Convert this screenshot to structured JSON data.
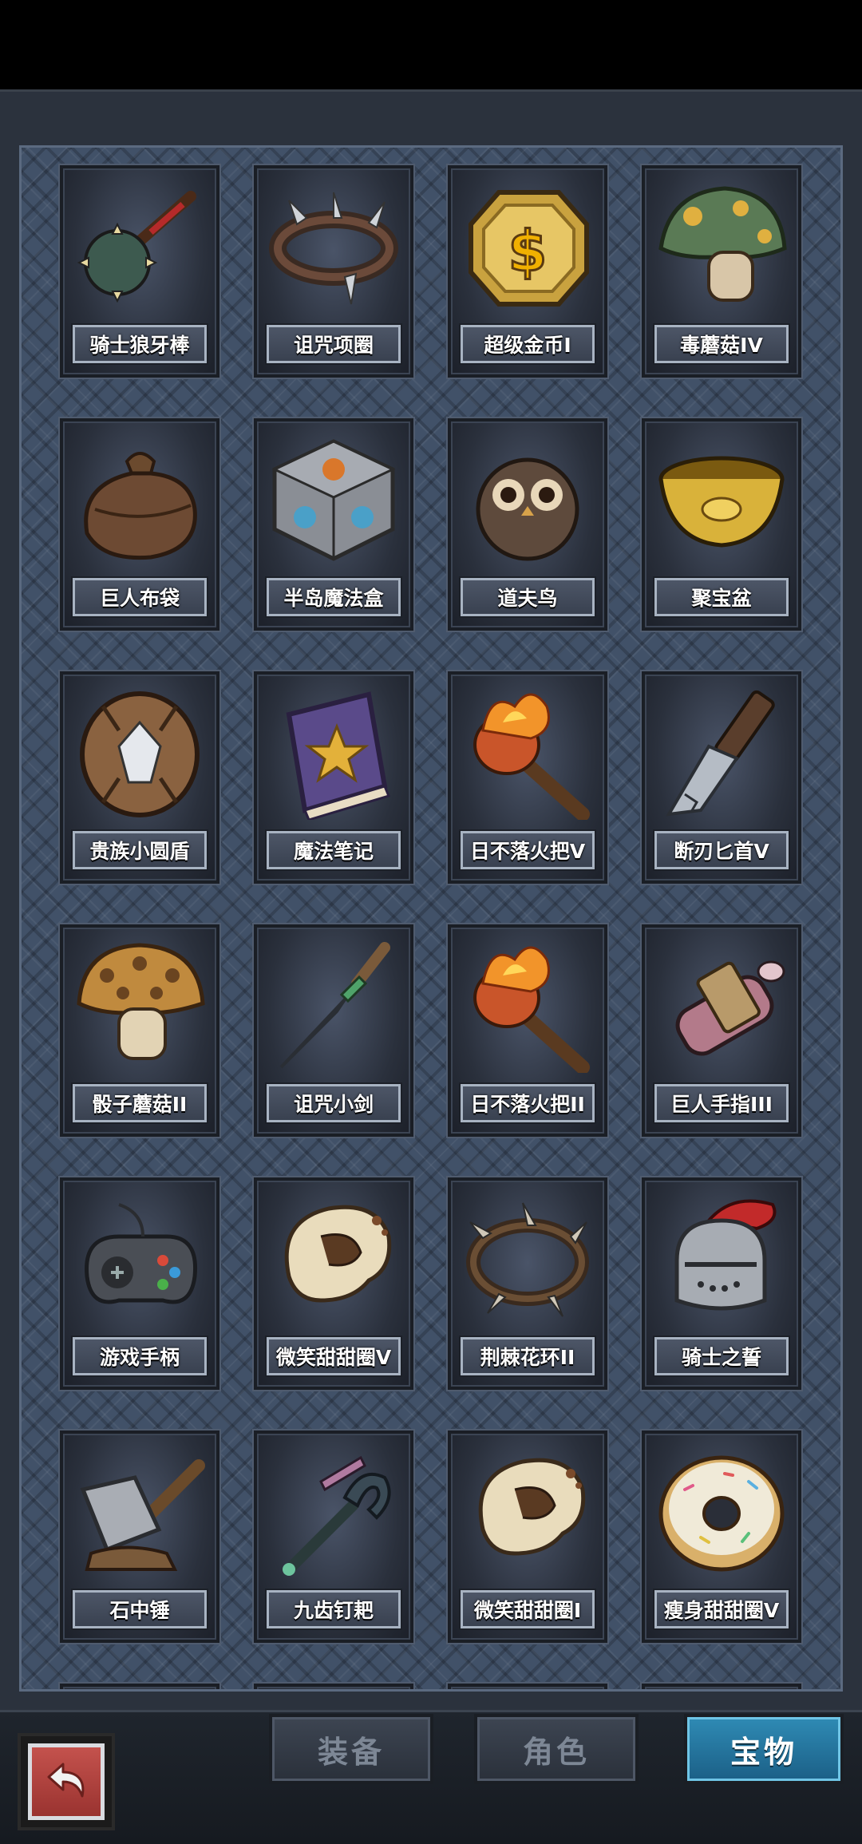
{
  "items": [
    {
      "name": "骑士狼牙棒",
      "icon": "spiked-mace-icon"
    },
    {
      "name": "诅咒项圈",
      "icon": "spiked-collar-icon"
    },
    {
      "name": "超级金币I",
      "icon": "gold-coin-icon"
    },
    {
      "name": "毒蘑菇IV",
      "icon": "poison-mushroom-icon"
    },
    {
      "name": "巨人布袋",
      "icon": "sack-icon"
    },
    {
      "name": "半岛魔法盒",
      "icon": "magic-cube-icon"
    },
    {
      "name": "道夫鸟",
      "icon": "owl-icon"
    },
    {
      "name": "聚宝盆",
      "icon": "treasure-bowl-icon"
    },
    {
      "name": "贵族小圆盾",
      "icon": "round-shield-icon"
    },
    {
      "name": "魔法笔记",
      "icon": "spellbook-icon"
    },
    {
      "name": "日不落火把V",
      "icon": "torch-icon"
    },
    {
      "name": "断刃匕首V",
      "icon": "broken-dagger-icon"
    },
    {
      "name": "骰子蘑菇II",
      "icon": "dice-mushroom-icon"
    },
    {
      "name": "诅咒小剑",
      "icon": "cursed-dagger-icon"
    },
    {
      "name": "日不落火把II",
      "icon": "torch-icon"
    },
    {
      "name": "巨人手指III",
      "icon": "giant-finger-icon"
    },
    {
      "name": "游戏手柄",
      "icon": "gamepad-icon"
    },
    {
      "name": "微笑甜甜圈V",
      "icon": "smile-donut-icon"
    },
    {
      "name": "荆棘花环II",
      "icon": "thorn-wreath-icon"
    },
    {
      "name": "骑士之誓",
      "icon": "knight-helmet-icon"
    },
    {
      "name": "石中锤",
      "icon": "stone-hammer-icon"
    },
    {
      "name": "九齿钉耙",
      "icon": "rake-icon"
    },
    {
      "name": "微笑甜甜圈I",
      "icon": "smile-donut-icon"
    },
    {
      "name": "瘦身甜甜圈V",
      "icon": "sprinkle-donut-icon"
    }
  ],
  "tabs": [
    {
      "label": "装备",
      "active": false
    },
    {
      "label": "角色",
      "active": false
    },
    {
      "label": "宝物",
      "active": true
    }
  ],
  "back_icon": "back-arrow-icon",
  "colors": {
    "accent_active_tab": "#1b5f86",
    "panel": "#415168"
  }
}
